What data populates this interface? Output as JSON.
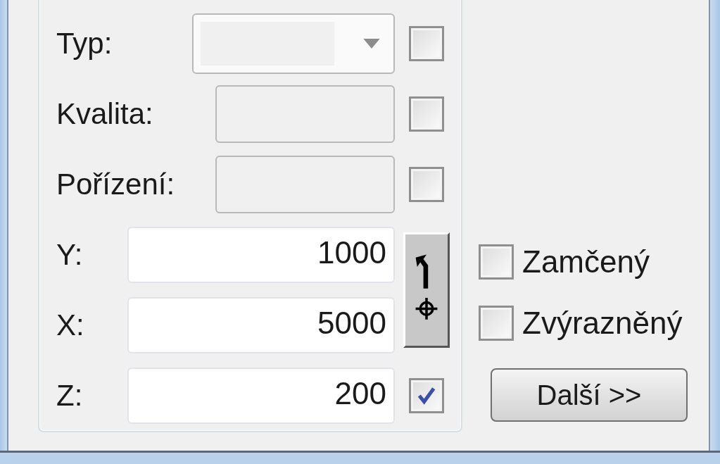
{
  "fields": [
    {
      "label": "Typ:",
      "kind": "combo",
      "disabled": true,
      "checked": false
    },
    {
      "label": "Kvalita:",
      "kind": "text",
      "disabled": true,
      "checked": false
    },
    {
      "label": "Pořízení:",
      "kind": "text",
      "disabled": true,
      "checked": false
    }
  ],
  "coordinates": [
    {
      "label": "Y:",
      "value": "1000",
      "kind": "plain"
    },
    {
      "label": "X:",
      "value": "5000",
      "kind": "plain"
    },
    {
      "label": "Z:",
      "value": "200",
      "kind": "checkable",
      "checked": true
    }
  ],
  "options": [
    {
      "label": "Zamčený",
      "checked": false
    },
    {
      "label": "Zvýrazněný",
      "checked": false
    }
  ],
  "next_button": "Další >>"
}
